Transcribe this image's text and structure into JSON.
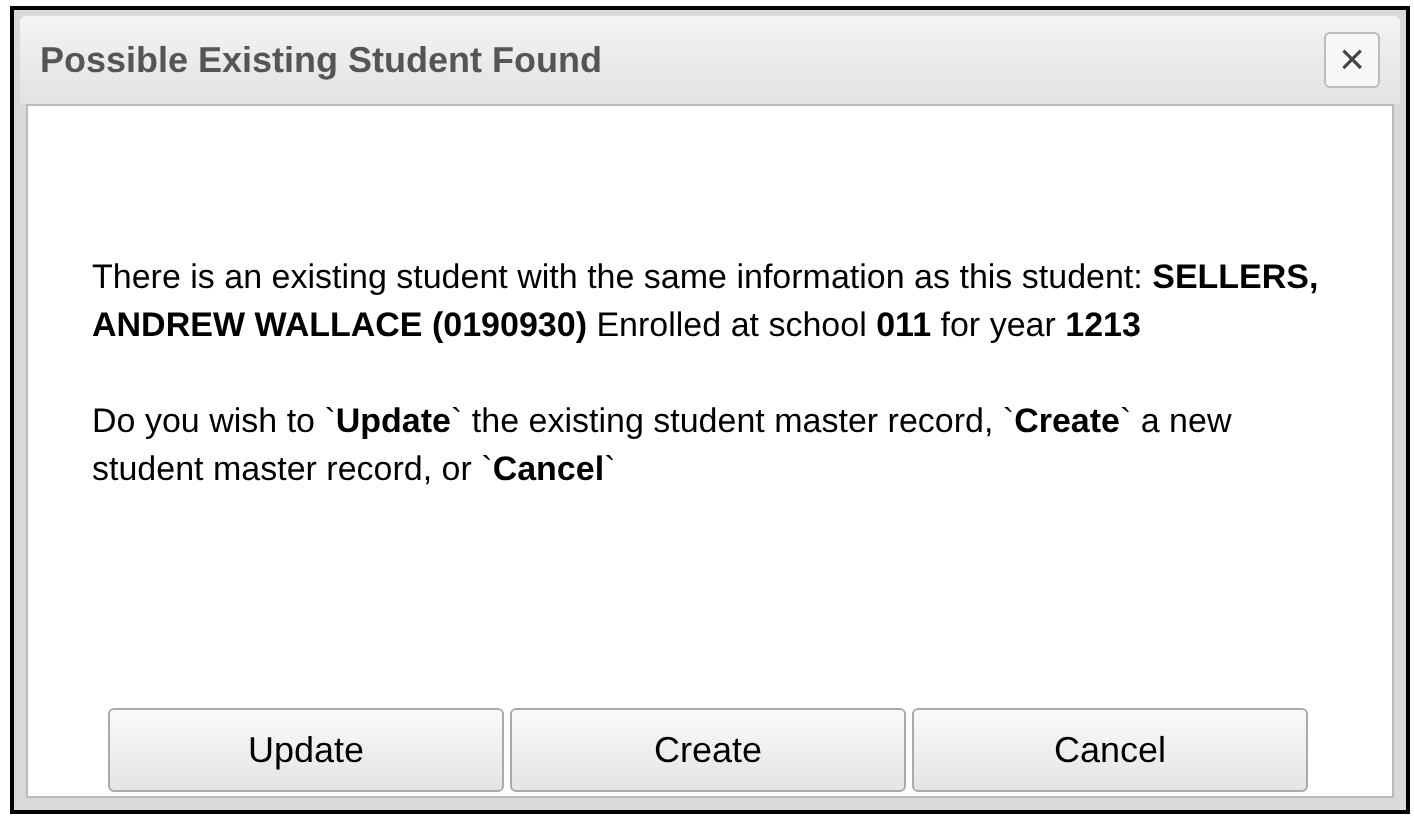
{
  "dialog": {
    "title": "Possible Existing Student Found",
    "close": "×"
  },
  "message": [
    "There is an existing student with the same information as this student: **SELLERS, ANDREW WALLACE (0190930)** Enrolled at school **011** for year **1213**",
    "Do you wish to `**Update**` the existing student master record, `**Create**` a new student master record, or `**Cancel**`"
  ],
  "buttons": [
    "Update",
    "Create",
    "Cancel"
  ]
}
